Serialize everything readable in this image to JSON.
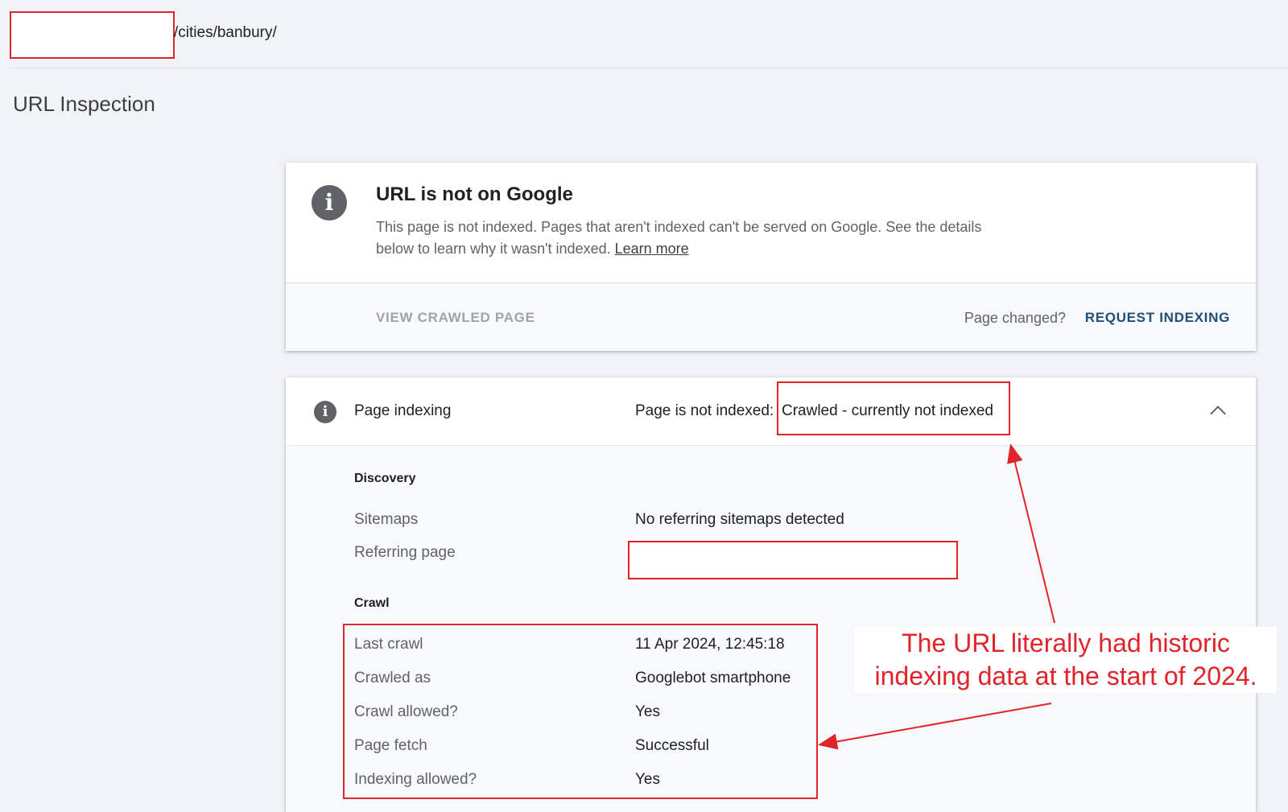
{
  "topbar": {
    "url_suffix": "/cities/banbury/"
  },
  "page": {
    "title": "URL Inspection"
  },
  "status_card": {
    "title": "URL is not on Google",
    "description": "This page is not indexed. Pages that aren't indexed can't be served on Google. See the details below to learn why it wasn't indexed.",
    "learn_more": "Learn more",
    "view_crawled": "VIEW CRAWLED PAGE",
    "page_changed": "Page changed?",
    "request_indexing": "REQUEST INDEXING"
  },
  "indexing_card": {
    "label": "Page indexing",
    "status_prefix": "Page is not indexed:",
    "status_value": "Crawled - currently not indexed",
    "discovery": {
      "title": "Discovery",
      "rows": [
        {
          "label": "Sitemaps",
          "value": "No referring sitemaps detected"
        },
        {
          "label": "Referring page",
          "value": ""
        }
      ]
    },
    "crawl": {
      "title": "Crawl",
      "rows": [
        {
          "label": "Last crawl",
          "value": "11 Apr 2024, 12:45:18"
        },
        {
          "label": "Crawled as",
          "value": "Googlebot smartphone"
        },
        {
          "label": "Crawl allowed?",
          "value": "Yes"
        },
        {
          "label": "Page fetch",
          "value": "Successful"
        },
        {
          "label": "Indexing allowed?",
          "value": "Yes"
        }
      ]
    }
  },
  "annotation": {
    "line1": "The URL literally had historic",
    "line2": "indexing data at the start of 2024.",
    "color": "#e1232b"
  }
}
